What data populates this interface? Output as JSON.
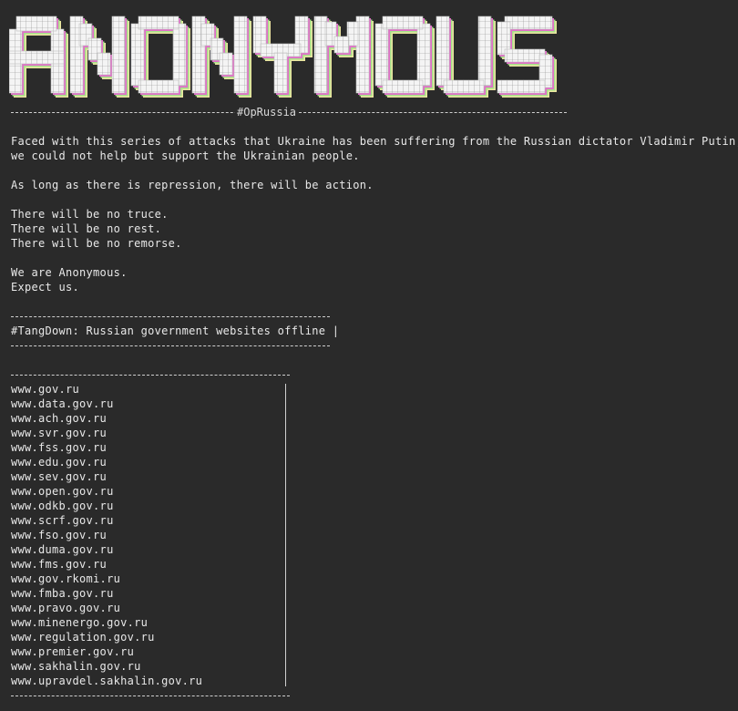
{
  "banner": {
    "text": "ANONYMOUS",
    "colors": {
      "face": "#f2f2f2",
      "grid": "#7a7a7a",
      "shadow_pink": "#e070c8",
      "shadow_green": "#a6e08a",
      "shadow_yellow": "#ece6a0",
      "outline": "#ffffff"
    }
  },
  "op_tag": "#OpRussia",
  "message": {
    "line1": "Faced with this series of attacks that Ukraine has been suffering from the Russian dictator Vladimir Putin,",
    "line2": "we could not help but support the Ukrainian people.",
    "line3": "As long as there is repression, there will be action.",
    "line4": "There will be no truce.",
    "line5": "There will be no rest.",
    "line6": "There will be no remorse.",
    "line7": "We are Anonymous.",
    "line8": "Expect us."
  },
  "tangdown_title": "#TangDown: Russian government websites offline |",
  "websites": [
    "www.gov.ru",
    "www.data.gov.ru",
    "www.ach.gov.ru",
    "www.svr.gov.ru",
    "www.fss.gov.ru",
    "www.edu.gov.ru",
    "www.sev.gov.ru",
    "www.open.gov.ru",
    "www.odkb.gov.ru",
    "www.scrf.gov.ru",
    "www.fso.gov.ru",
    "www.duma.gov.ru",
    "www.fms.gov.ru",
    "www.gov.rkomi.ru",
    "www.fmba.gov.ru",
    "www.pravo.gov.ru",
    "www.minenergo.gov.ru",
    "www.regulation.gov.ru",
    "www.premier.gov.ru",
    "www.sakhalin.gov.ru",
    "www.upravdel.sakhalin.gov.ru"
  ],
  "colors": {
    "background": "#2a2a2a",
    "text": "#e8e8e8"
  }
}
